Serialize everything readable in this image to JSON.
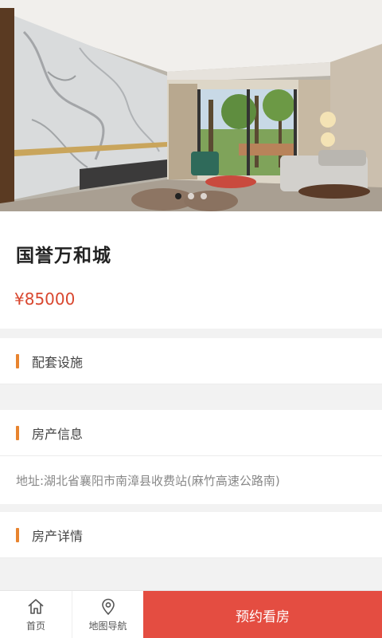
{
  "hero": {
    "image": "living-room-photo",
    "slides": 3,
    "active_slide": 1
  },
  "property": {
    "name": "国誉万和城",
    "price": "¥85000"
  },
  "sections": {
    "facilities": {
      "title": "配套设施"
    },
    "info": {
      "title": "房产信息",
      "address": "地址:湖北省襄阳市南漳县收费站(麻竹高速公路南)"
    },
    "details": {
      "title": "房产详情"
    }
  },
  "tabbar": {
    "home": {
      "label": "首页",
      "icon": "home-icon"
    },
    "map": {
      "label": "地图导航",
      "icon": "location-pin-icon"
    },
    "book_label": "预约看房"
  },
  "colors": {
    "accent": "#e8842f",
    "price": "#d9472f",
    "book_button": "#e44d41"
  }
}
